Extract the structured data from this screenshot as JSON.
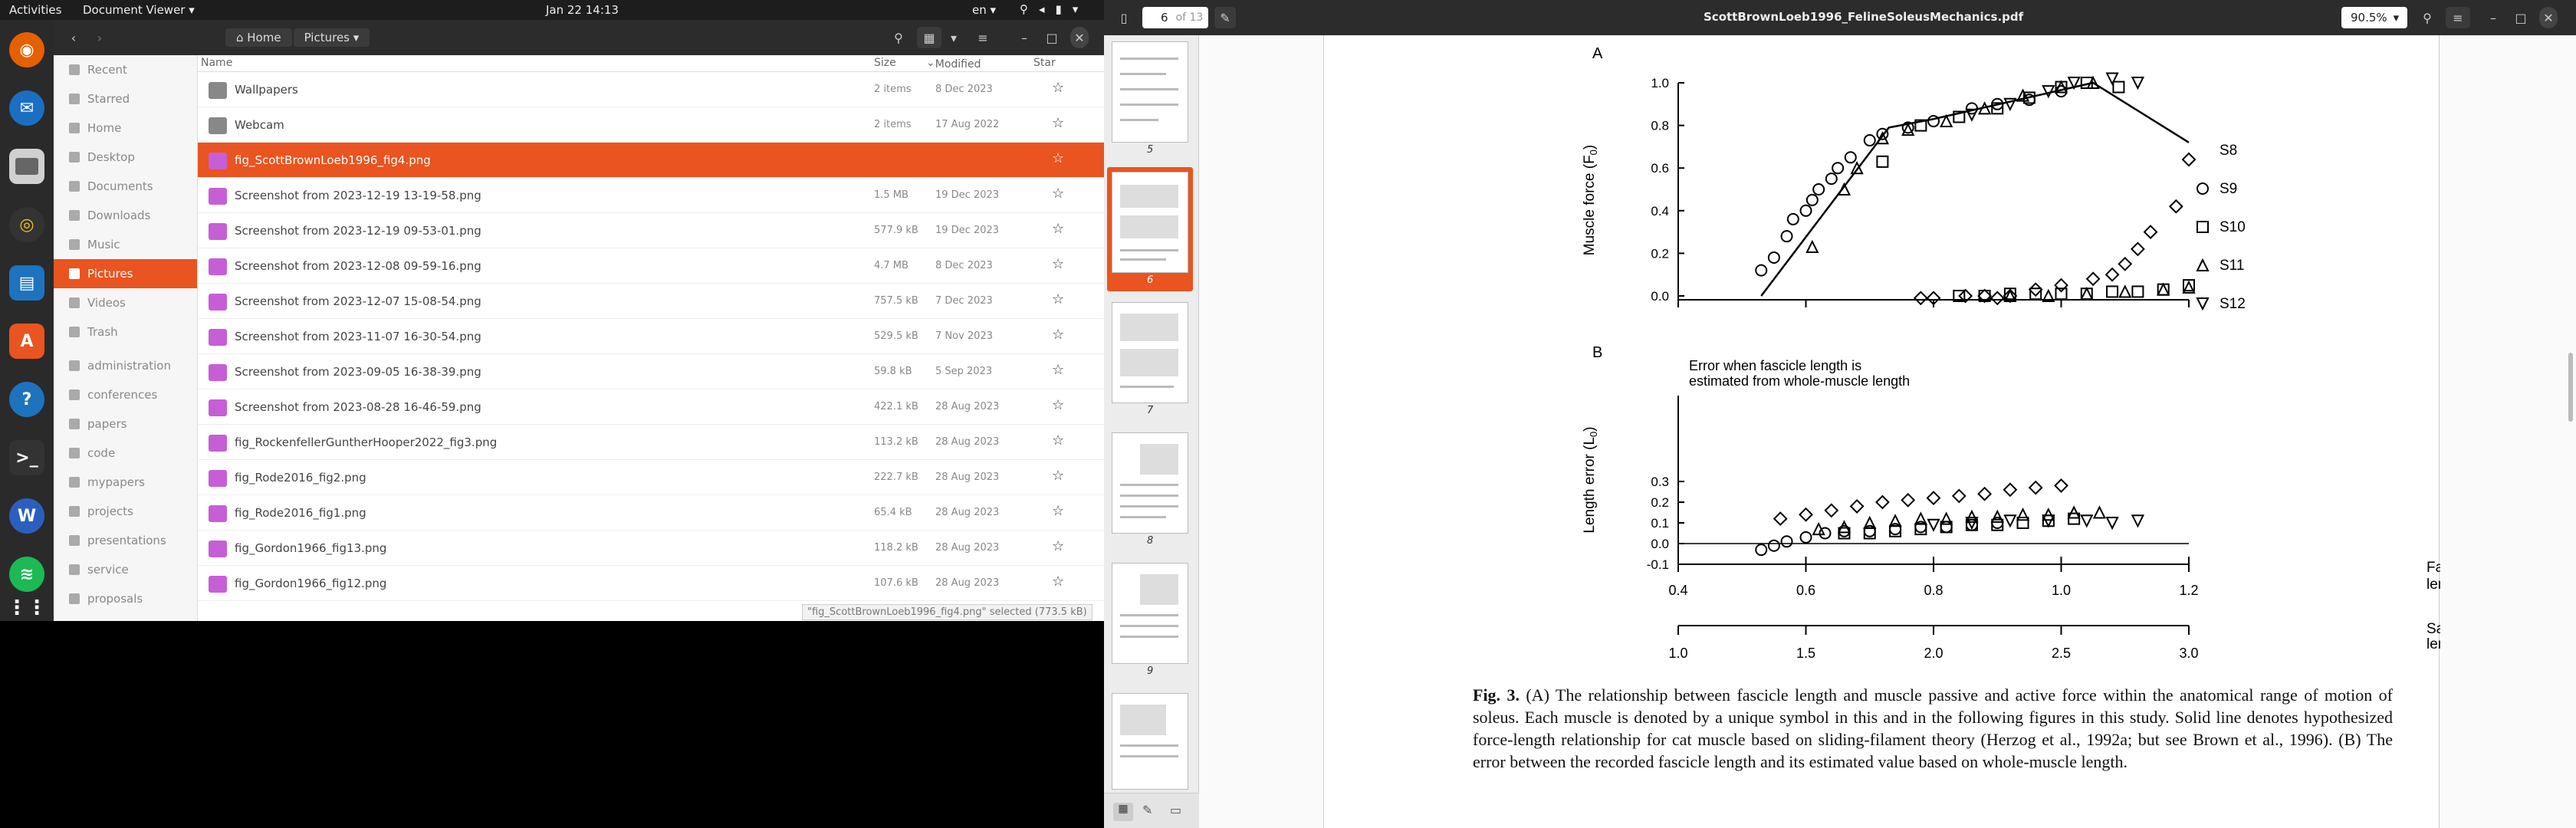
{
  "topbar": {
    "activities": "Activities",
    "app_name": "Document Viewer",
    "clock": "Jan 22  14:13",
    "lang": "en"
  },
  "files": {
    "path": [
      "Home",
      "Pictures"
    ],
    "columns": {
      "name": "Name",
      "size": "Size",
      "modified": "Modified",
      "star": "Star"
    },
    "sidebar": [
      {
        "label": "Recent",
        "icon": "clock-icon"
      },
      {
        "label": "Starred",
        "icon": "star-icon"
      },
      {
        "label": "Home",
        "icon": "home-icon"
      },
      {
        "label": "Desktop",
        "icon": "folder-icon"
      },
      {
        "label": "Documents",
        "icon": "folder-icon"
      },
      {
        "label": "Downloads",
        "icon": "folder-icon"
      },
      {
        "label": "Music",
        "icon": "music-icon"
      },
      {
        "label": "Pictures",
        "icon": "folder-icon",
        "selected": true
      },
      {
        "label": "Videos",
        "icon": "folder-icon"
      },
      {
        "label": "Trash",
        "icon": "trash-icon"
      },
      {
        "label": "administration",
        "icon": "folder-icon"
      },
      {
        "label": "conferences",
        "icon": "folder-icon"
      },
      {
        "label": "papers",
        "icon": "folder-icon"
      },
      {
        "label": "code",
        "icon": "folder-icon"
      },
      {
        "label": "mypapers",
        "icon": "folder-icon"
      },
      {
        "label": "projects",
        "icon": "folder-icon"
      },
      {
        "label": "presentations",
        "icon": "folder-icon"
      },
      {
        "label": "service",
        "icon": "folder-icon"
      },
      {
        "label": "proposals",
        "icon": "folder-icon"
      }
    ],
    "rows": [
      {
        "name": "Wallpapers",
        "size": "2 items",
        "modified": "8 Dec 2023",
        "type": "folder"
      },
      {
        "name": "Webcam",
        "size": "2 items",
        "modified": "17 Aug 2022",
        "type": "folder"
      },
      {
        "name": "fig_ScottBrownLoeb1996_fig4.png",
        "size": "",
        "modified": "",
        "type": "image",
        "selected": true
      },
      {
        "name": "Screenshot from 2023-12-19 13-19-58.png",
        "size": "1.5 MB",
        "modified": "19 Dec 2023",
        "type": "image"
      },
      {
        "name": "Screenshot from 2023-12-19 09-53-01.png",
        "size": "577.9 kB",
        "modified": "19 Dec 2023",
        "type": "image"
      },
      {
        "name": "Screenshot from 2023-12-08 09-59-16.png",
        "size": "4.7 MB",
        "modified": "8 Dec 2023",
        "type": "image"
      },
      {
        "name": "Screenshot from 2023-12-07 15-08-54.png",
        "size": "757.5 kB",
        "modified": "7 Dec 2023",
        "type": "image"
      },
      {
        "name": "Screenshot from 2023-11-07 16-30-54.png",
        "size": "529.5 kB",
        "modified": "7 Nov 2023",
        "type": "image"
      },
      {
        "name": "Screenshot from 2023-09-05 16-38-39.png",
        "size": "59.8 kB",
        "modified": "5 Sep 2023",
        "type": "image"
      },
      {
        "name": "Screenshot from 2023-08-28 16-46-59.png",
        "size": "422.1 kB",
        "modified": "28 Aug 2023",
        "type": "image"
      },
      {
        "name": "fig_RockenfellerGuntherHooper2022_fig3.png",
        "size": "113.2 kB",
        "modified": "28 Aug 2023",
        "type": "image"
      },
      {
        "name": "fig_Rode2016_fig2.png",
        "size": "222.7 kB",
        "modified": "28 Aug 2023",
        "type": "image"
      },
      {
        "name": "fig_Rode2016_fig1.png",
        "size": "65.4 kB",
        "modified": "28 Aug 2023",
        "type": "image"
      },
      {
        "name": "fig_Gordon1966_fig13.png",
        "size": "118.2 kB",
        "modified": "28 Aug 2023",
        "type": "image"
      },
      {
        "name": "fig_Gordon1966_fig12.png",
        "size": "107.6 kB",
        "modified": "28 Aug 2023",
        "type": "image"
      }
    ],
    "status": "\"fig_ScottBrownLoeb1996_fig4.png\" selected (773.5 kB)"
  },
  "viewer": {
    "page_current": "6",
    "page_of": "of 13",
    "title": "ScottBrownLoeb1996_FelineSoleusMechanics.pdf",
    "zoom": "90.5%",
    "thumb_labels": [
      "5",
      "6",
      "7",
      "8",
      "9"
    ]
  },
  "figure": {
    "panel_a": "A",
    "panel_b": "B",
    "ylabel_a": "Muscle force (F",
    "ylabel_a_sub": "0",
    "ylabel_b": "Length error (L",
    "ylabel_b_sub": "0",
    "b_note_1": "Error when fascicle length is",
    "b_note_2": "estimated from whole-muscle length",
    "legend": [
      "S8",
      "S9",
      "S10",
      "S11",
      "S12"
    ],
    "yticks_a": [
      "1.0",
      "0.8",
      "0.6",
      "0.4",
      "0.2",
      "0.0"
    ],
    "yticks_b": [
      "0.3",
      "0.2",
      "0.1",
      "0.0",
      "-0.1"
    ],
    "xticks_fascicle": [
      "0.4",
      "0.6",
      "0.8",
      "1.0",
      "1.2"
    ],
    "xticks_sarcomere": [
      "1.0",
      "1.5",
      "2.0",
      "2.5",
      "3.0"
    ],
    "xlabel_fascicle_1": "Fascicle",
    "xlabel_fascicle_2": "length (L",
    "xlabel_sarcomere_1": "Sarcomere",
    "xlabel_sarcomere_2": "length (µm)",
    "caption_bold": "Fig. 3.",
    "caption": " (A) The relationship between fascicle length and muscle passive and active force within the anatomical range of motion of soleus. Each muscle is denoted by a unique symbol in this and in the following figures in this study. Solid line denotes hypothesized force-length relationship for cat muscle based on sliding-filament theory (Herzog et al., 1992a; but see Brown et al., 1996). (B) The error between the recorded fascicle length and its estimated value based on whole-muscle length."
  }
}
